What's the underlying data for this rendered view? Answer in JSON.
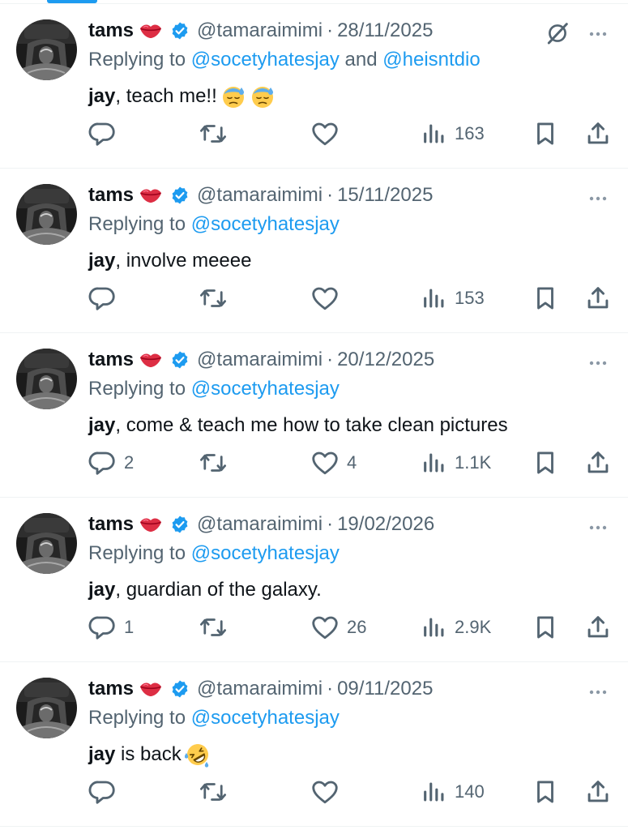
{
  "tweets": [
    {
      "name": "tams",
      "handle": "@tamaraimimi",
      "date": "28/11/2025",
      "replying_prefix": "Replying to",
      "mention1": "@socetyhatesjay",
      "and": " and ",
      "mention2": "@heisntdio",
      "text_bold": "jay",
      "text_rest": ", teach me!!",
      "emojis": [
        "downcast-sweat-face",
        "downcast-sweat-face"
      ],
      "show_grok": true,
      "replies": "",
      "reposts": "",
      "likes": "",
      "views": "163"
    },
    {
      "name": "tams",
      "handle": "@tamaraimimi",
      "date": "15/11/2025",
      "replying_prefix": "Replying to",
      "mention1": "@socetyhatesjay",
      "text_bold": "jay",
      "text_rest": ", involve meeee",
      "emojis": [],
      "replies": "",
      "reposts": "",
      "likes": "",
      "views": "153"
    },
    {
      "name": "tams",
      "handle": "@tamaraimimi",
      "date": "20/12/2025",
      "replying_prefix": "Replying to",
      "mention1": "@socetyhatesjay",
      "text_bold": "jay",
      "text_rest": ", come & teach me how to take clean pictures",
      "emojis": [],
      "replies": "2",
      "reposts": "",
      "likes": "4",
      "views": "1.1K"
    },
    {
      "name": "tams",
      "handle": "@tamaraimimi",
      "date": "19/02/2026",
      "replying_prefix": "Replying to",
      "mention1": "@socetyhatesjay",
      "text_bold": "jay",
      "text_rest": ", guardian of the galaxy.",
      "emojis": [],
      "replies": "1",
      "reposts": "",
      "likes": "26",
      "views": "2.9K"
    },
    {
      "name": "tams",
      "handle": "@tamaraimimi",
      "date": "09/11/2025",
      "replying_prefix": "Replying to",
      "mention1": "@socetyhatesjay",
      "text_bold": "jay",
      "text_rest": " is back",
      "emojis": [
        "rolling-on-floor-laughing"
      ],
      "replies": "",
      "reposts": "",
      "likes": "",
      "views": "140"
    }
  ],
  "icons": {
    "name_emoji": "kiss-lips-icon",
    "verified": "verified-badge-icon",
    "grok": "grok-icon",
    "more": "more-dots-icon",
    "reply": "reply-icon",
    "repost": "repost-icon",
    "like": "heart-icon",
    "views": "views-icon",
    "bookmark": "bookmark-icon",
    "share": "share-icon"
  },
  "colors": {
    "text": "#0f1419",
    "secondary": "#536471",
    "accent": "#1d9bf0",
    "divider": "#eff3f4"
  },
  "separator": "·"
}
